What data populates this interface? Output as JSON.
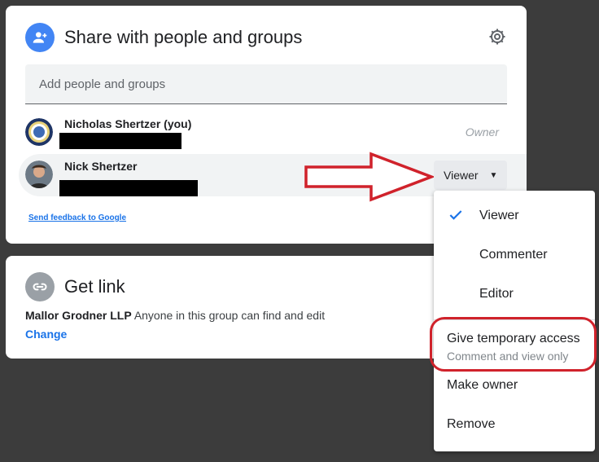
{
  "share": {
    "title": "Share with people and groups",
    "add_placeholder": "Add people and groups",
    "people": [
      {
        "name": "Nicholas Shertzer (you)",
        "role": "Owner"
      },
      {
        "name": "Nick Shertzer",
        "role": "Viewer"
      }
    ],
    "feedback_link": "Send feedback to Google"
  },
  "link": {
    "title": "Get link",
    "org": "Mallor Grodner LLP",
    "description": "Anyone in this group can find and edit",
    "change_label": "Change"
  },
  "role_menu": {
    "items": [
      {
        "label": "Viewer",
        "selected": true
      },
      {
        "label": "Commenter"
      },
      {
        "label": "Editor"
      },
      {
        "label": "Give temporary access",
        "sub": "Comment and view only"
      },
      {
        "label": "Make owner"
      },
      {
        "label": "Remove"
      }
    ]
  },
  "colors": {
    "accent": "#1a73e8",
    "annotation": "#d0222b",
    "icon_link_bg": "#9aa0a6"
  }
}
